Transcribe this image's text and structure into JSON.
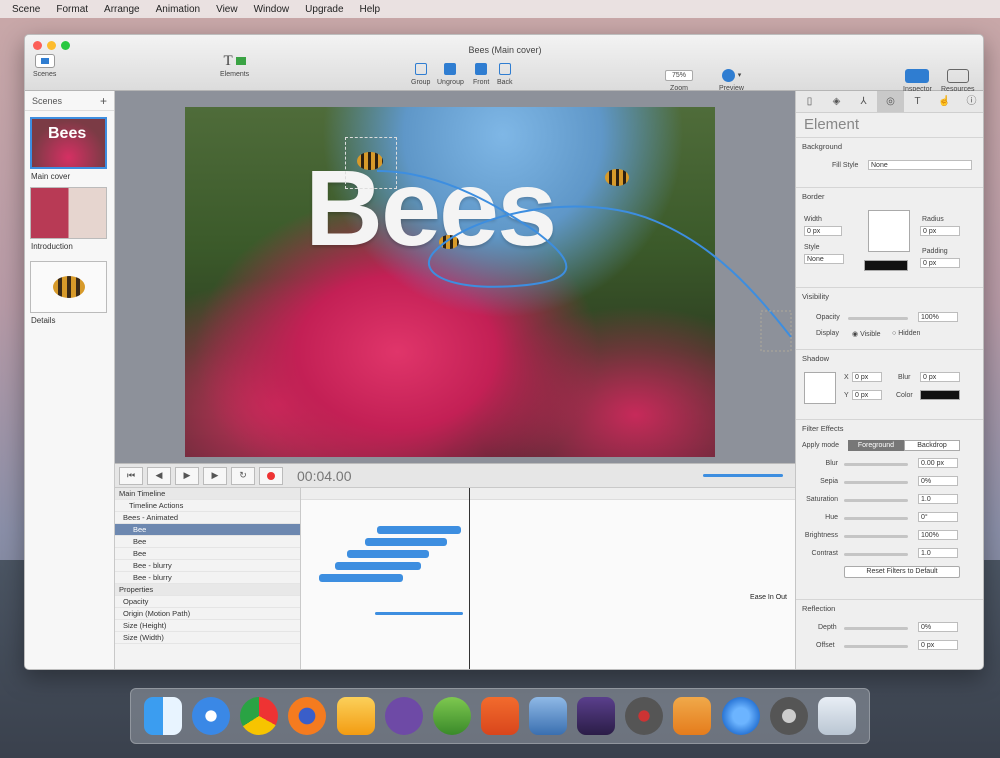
{
  "menu": [
    "Scene",
    "Format",
    "Arrange",
    "Animation",
    "View",
    "Window",
    "Upgrade",
    "Help"
  ],
  "window": {
    "title": "Bees (Main cover)"
  },
  "toolbar": {
    "scenes": "Scenes",
    "elements": "Elements",
    "group": "Group",
    "ungroup": "Ungroup",
    "front": "Front",
    "back": "Back",
    "zoom_value": "75%",
    "zoom": "Zoom",
    "preview": "Preview",
    "inspector": "Inspector",
    "resources": "Resources"
  },
  "sidebar": {
    "header": "Scenes",
    "add": "+",
    "items": [
      {
        "label": "Main cover",
        "thumb_text": "Bees"
      },
      {
        "label": "Introduction"
      },
      {
        "label": "Details"
      }
    ]
  },
  "canvas": {
    "headline": "Bees"
  },
  "timeline": {
    "time": "00:04.00",
    "rows": [
      "Main Timeline",
      "Timeline Actions",
      "Bees - Animated",
      "Bee",
      "Bee",
      "Bee",
      "Bee - blurry",
      "Bee - blurry"
    ],
    "properties_header": "Properties",
    "properties": [
      "Opacity",
      "Origin (Motion Path)",
      "Size (Height)",
      "Size (Width)"
    ],
    "easing": "Ease In Out"
  },
  "inspector": {
    "title": "Element",
    "background": {
      "header": "Background",
      "fill_label": "Fill Style",
      "fill_value": "None"
    },
    "border": {
      "header": "Border",
      "width_label": "Width",
      "width": "0 px",
      "style_label": "Style",
      "style": "None",
      "radius_label": "Radius",
      "radius": "0 px",
      "padding_label": "Padding",
      "padding": "0 px"
    },
    "visibility": {
      "header": "Visibility",
      "opacity_label": "Opacity",
      "opacity": "100%",
      "display_label": "Display",
      "visible": "Visible",
      "hidden": "Hidden"
    },
    "shadow": {
      "header": "Shadow",
      "x_label": "X",
      "x": "0 px",
      "y_label": "Y",
      "y": "0 px",
      "blur_label": "Blur",
      "blur": "0 px",
      "color_label": "Color"
    },
    "filter": {
      "header": "Filter Effects",
      "apply_label": "Apply mode",
      "foreground": "Foreground",
      "backdrop": "Backdrop",
      "rows": [
        {
          "label": "Blur",
          "value": "0.00 px"
        },
        {
          "label": "Sepia",
          "value": "0%"
        },
        {
          "label": "Saturation",
          "value": "1.0"
        },
        {
          "label": "Hue",
          "value": "0°"
        },
        {
          "label": "Brightness",
          "value": "100%"
        },
        {
          "label": "Contrast",
          "value": "1.0"
        }
      ],
      "reset": "Reset Filters to Default"
    },
    "reflection": {
      "header": "Reflection",
      "depth_label": "Depth",
      "depth": "0%",
      "offset_label": "Offset",
      "offset": "0 px"
    }
  }
}
